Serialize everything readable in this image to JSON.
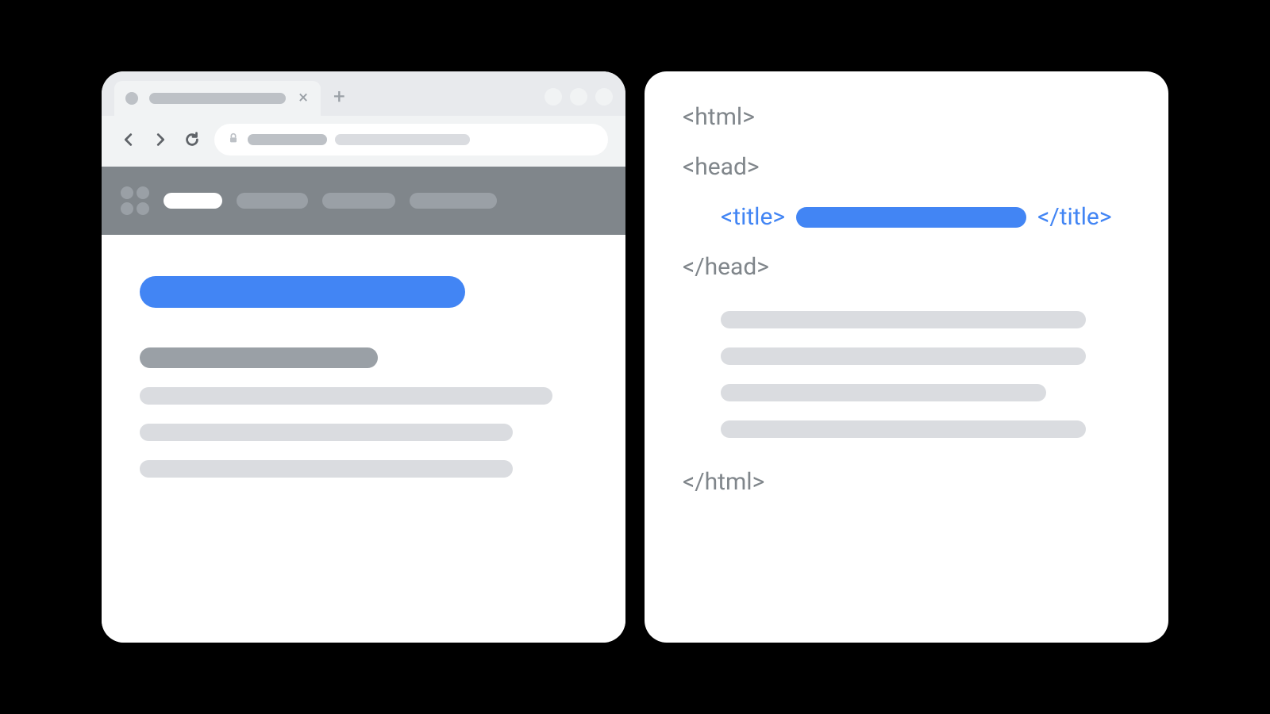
{
  "colors": {
    "accent_blue": "#4285f4",
    "grey_header": "#80868b",
    "grey_mid": "#9aa0a6",
    "grey_light": "#dadce0",
    "chrome_bg": "#e8eaed",
    "toolbar_bg": "#f1f3f4"
  },
  "browser": {
    "tab_close_glyph": "×",
    "new_tab_glyph": "+"
  },
  "code": {
    "tag_html_open": "<html>",
    "tag_head_open": "<head>",
    "tag_title_open": "<title>",
    "tag_title_close": "</title>",
    "tag_head_close": "</head>",
    "tag_html_close": "</html>"
  }
}
